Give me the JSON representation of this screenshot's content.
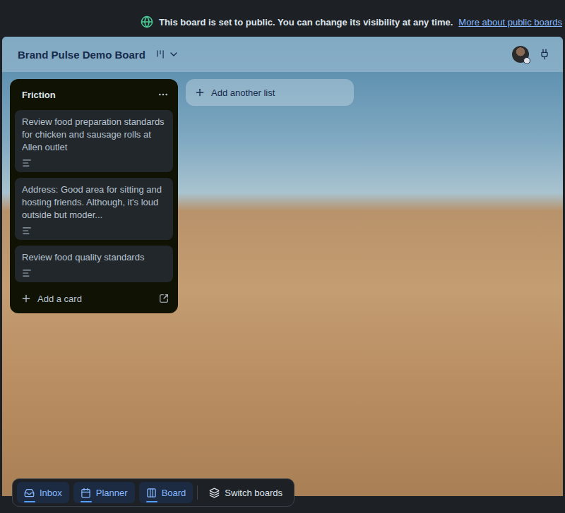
{
  "banner": {
    "text": "This board is set to public. You can change its visibility at any time.",
    "link": "More about public boards"
  },
  "board": {
    "title": "Brand Pulse Demo Board"
  },
  "lists": [
    {
      "title": "Friction",
      "add_card": "Add a card",
      "cards": [
        {
          "text": "Review food preparation standards for chicken and sausage rolls at Allen outlet",
          "has_description": true
        },
        {
          "text": "Address: Good area for sitting and hosting friends. Although, it's loud outside but moder...",
          "has_description": true
        },
        {
          "text": "Review food quality standards",
          "has_description": true
        }
      ]
    }
  ],
  "add_list": "Add another list",
  "bottom_nav": [
    {
      "label": "Inbox",
      "selected": true
    },
    {
      "label": "Planner",
      "selected": true
    },
    {
      "label": "Board",
      "selected": true
    },
    {
      "label": "Switch boards",
      "selected": false
    }
  ]
}
